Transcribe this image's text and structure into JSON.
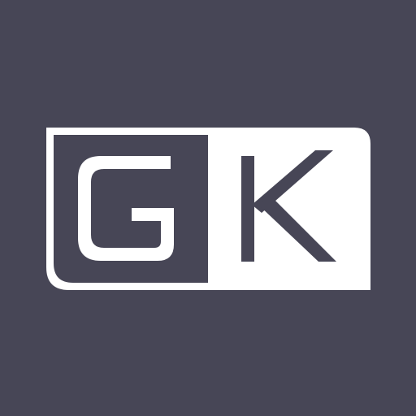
{
  "logo": {
    "text": "GK",
    "colors": {
      "background": "#474656",
      "foreground": "#FFFFFF"
    }
  }
}
